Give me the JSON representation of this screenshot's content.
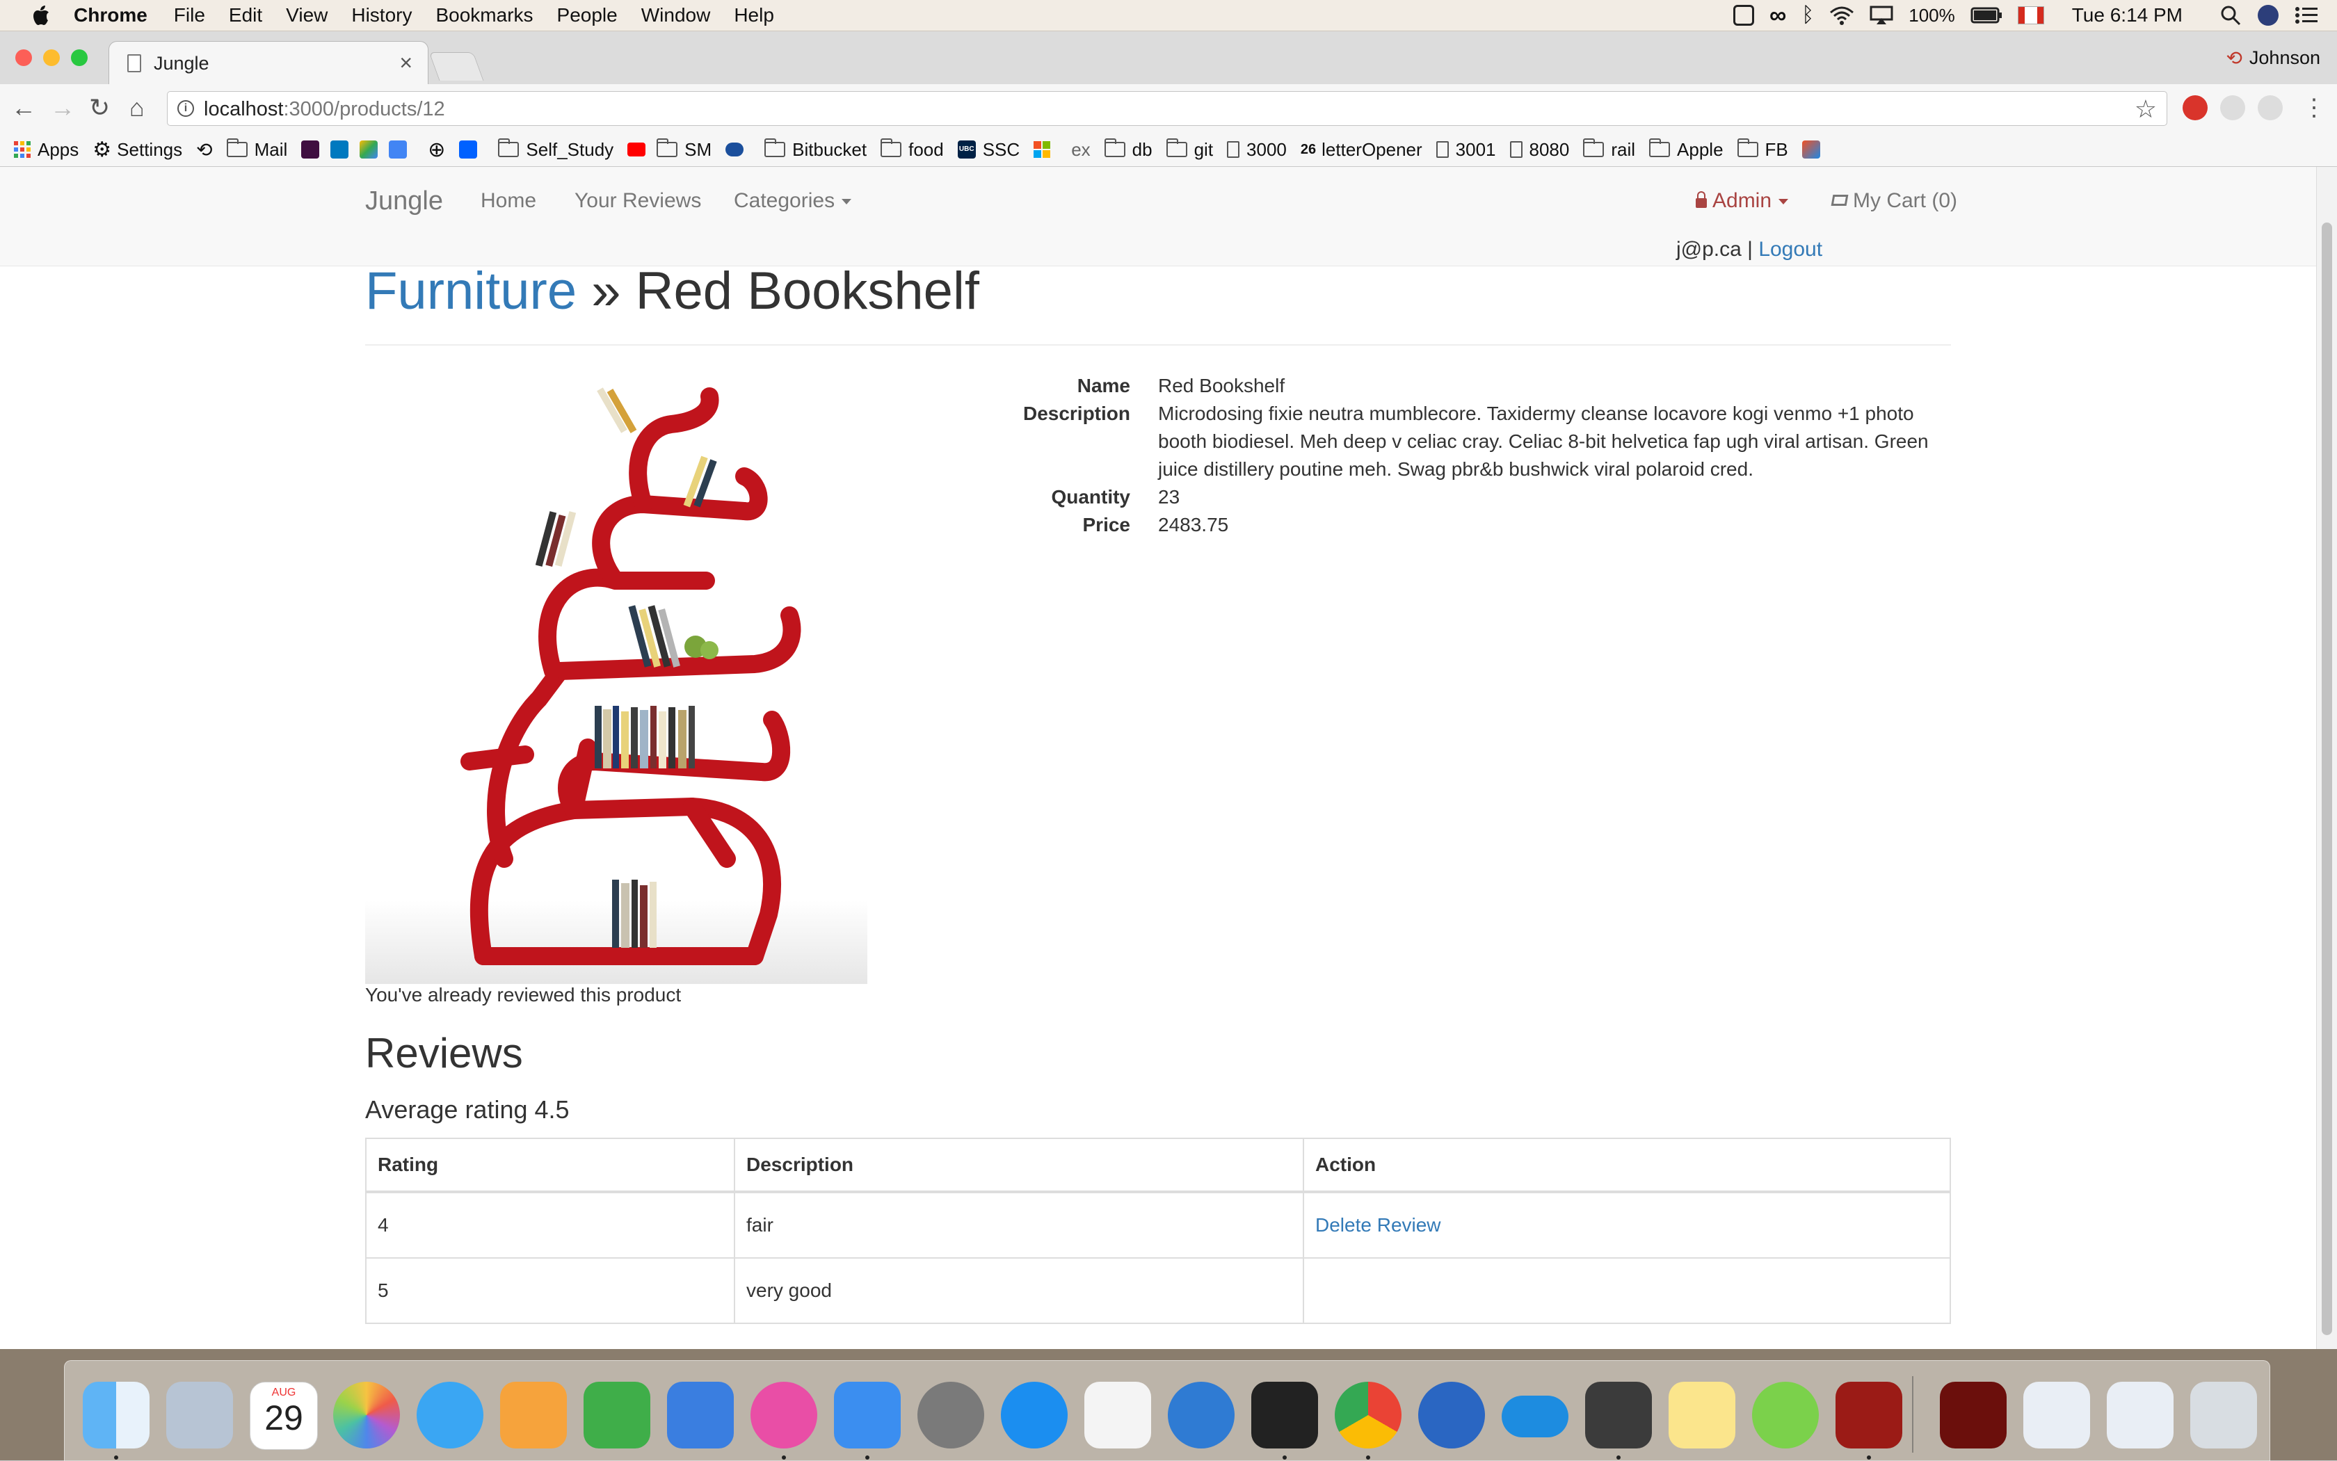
{
  "menubar": {
    "app": "Chrome",
    "items": [
      "File",
      "Edit",
      "View",
      "History",
      "Bookmarks",
      "People",
      "Window",
      "Help"
    ],
    "battery": "100%",
    "clock": "Tue 6:14 PM"
  },
  "tab": {
    "title": "Jungle"
  },
  "profile": {
    "name": "Johnson"
  },
  "omnibox": {
    "host": "localhost",
    "path": ":3000/products/12"
  },
  "bookmarks": [
    "Apps",
    "Settings",
    "Mail",
    "Self_Study",
    "SM",
    "Bitbucket",
    "food",
    "SSC",
    "ex",
    "db",
    "git",
    "3000",
    "letterOpener",
    "3001",
    "8080",
    "rail",
    "Apple",
    "FB"
  ],
  "bookmark_badges": {
    "ssc": "UBC",
    "letteropener": "26"
  },
  "navbar": {
    "brand": "Jungle",
    "home": "Home",
    "your_reviews": "Your Reviews",
    "categories": "Categories",
    "admin": "Admin",
    "cart": "My Cart (0)",
    "email": "j@p.ca",
    "separator": "|",
    "logout": "Logout"
  },
  "product": {
    "category": "Furniture",
    "separator": "»",
    "name": "Red Bookshelf",
    "already_reviewed": "You've already reviewed this product",
    "details": {
      "name_label": "Name",
      "name": "Red Bookshelf",
      "description_label": "Description",
      "description": "Microdosing fixie neutra mumblecore. Taxidermy cleanse locavore kogi venmo +1 photo booth biodiesel. Meh deep v celiac cray. Celiac 8-bit helvetica fap ugh viral artisan. Green juice distillery poutine meh. Swag pbr&b bushwick viral polaroid cred.",
      "quantity_label": "Quantity",
      "quantity": "23",
      "price_label": "Price",
      "price": "2483.75"
    }
  },
  "reviews": {
    "title": "Reviews",
    "average": "Average rating 4.5",
    "headers": [
      "Rating",
      "Description",
      "Action"
    ],
    "rows": [
      {
        "rating": "4",
        "description": "fair",
        "action": "Delete Review"
      },
      {
        "rating": "5",
        "description": "very good",
        "action": ""
      }
    ]
  },
  "dock": {
    "calendar_month": "AUG",
    "calendar_day": "29",
    "apps": [
      "finder-icon",
      "launchpad-icon",
      "calendar-icon",
      "photos-icon",
      "messages-icon",
      "pages-icon",
      "numbers-icon",
      "keynote-icon",
      "itunes-icon",
      "xcode-icon",
      "system-preferences-icon",
      "app-store-icon",
      "slack-icon",
      "globe-icon",
      "terminal-icon",
      "chrome-icon",
      "r-icon",
      "onedrive-icon",
      "sublime-text-icon",
      "notes-icon",
      "wechat-icon",
      "acrobat-icon",
      "acrobat-doc-icon",
      "downloads-icon",
      "documents-icon",
      "trash-icon"
    ]
  },
  "colors": {
    "link": "#337ab7",
    "admin": "#a94442",
    "bookshelf": "#c0141c"
  }
}
